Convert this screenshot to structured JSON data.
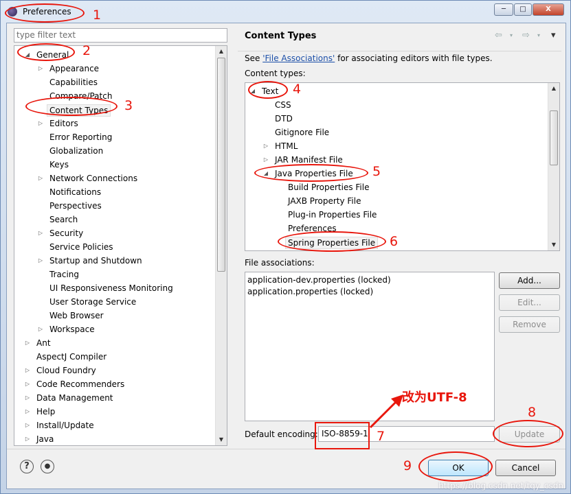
{
  "window": {
    "title": "Preferences",
    "minimize": "─",
    "maximize": "□",
    "close": "X"
  },
  "filter": {
    "placeholder": "type filter text"
  },
  "left_tree": [
    {
      "label": "General",
      "level": 0,
      "twisty": "expanded"
    },
    {
      "label": "Appearance",
      "level": 1,
      "twisty": "collapsed"
    },
    {
      "label": "Capabilities",
      "level": 1,
      "twisty": "none"
    },
    {
      "label": "Compare/Patch",
      "level": 1,
      "twisty": "none"
    },
    {
      "label": "Content Types",
      "level": 1,
      "twisty": "none",
      "selected": true
    },
    {
      "label": "Editors",
      "level": 1,
      "twisty": "collapsed"
    },
    {
      "label": "Error Reporting",
      "level": 1,
      "twisty": "none"
    },
    {
      "label": "Globalization",
      "level": 1,
      "twisty": "none"
    },
    {
      "label": "Keys",
      "level": 1,
      "twisty": "none"
    },
    {
      "label": "Network Connections",
      "level": 1,
      "twisty": "collapsed"
    },
    {
      "label": "Notifications",
      "level": 1,
      "twisty": "none"
    },
    {
      "label": "Perspectives",
      "level": 1,
      "twisty": "none"
    },
    {
      "label": "Search",
      "level": 1,
      "twisty": "none"
    },
    {
      "label": "Security",
      "level": 1,
      "twisty": "collapsed"
    },
    {
      "label": "Service Policies",
      "level": 1,
      "twisty": "none"
    },
    {
      "label": "Startup and Shutdown",
      "level": 1,
      "twisty": "collapsed"
    },
    {
      "label": "Tracing",
      "level": 1,
      "twisty": "none"
    },
    {
      "label": "UI Responsiveness Monitoring",
      "level": 1,
      "twisty": "none"
    },
    {
      "label": "User Storage Service",
      "level": 1,
      "twisty": "none"
    },
    {
      "label": "Web Browser",
      "level": 1,
      "twisty": "none"
    },
    {
      "label": "Workspace",
      "level": 1,
      "twisty": "collapsed"
    },
    {
      "label": "Ant",
      "level": 0,
      "twisty": "collapsed"
    },
    {
      "label": "AspectJ Compiler",
      "level": 0,
      "twisty": "none"
    },
    {
      "label": "Cloud Foundry",
      "level": 0,
      "twisty": "collapsed"
    },
    {
      "label": "Code Recommenders",
      "level": 0,
      "twisty": "collapsed"
    },
    {
      "label": "Data Management",
      "level": 0,
      "twisty": "collapsed"
    },
    {
      "label": "Help",
      "level": 0,
      "twisty": "collapsed"
    },
    {
      "label": "Install/Update",
      "level": 0,
      "twisty": "collapsed"
    },
    {
      "label": "Java",
      "level": 0,
      "twisty": "collapsed"
    }
  ],
  "page": {
    "title": "Content Types",
    "description_prefix": "See ",
    "description_link": "'File Associations'",
    "description_suffix": " for associating editors with file types.",
    "content_types_label": "Content types:",
    "file_assoc_label": "File associations:",
    "encoding_label": "Default encoding:",
    "encoding_value": "ISO-8859-1"
  },
  "content_tree": [
    {
      "label": "Text",
      "level": 0,
      "twisty": "expanded"
    },
    {
      "label": "CSS",
      "level": 1,
      "twisty": "none"
    },
    {
      "label": "DTD",
      "level": 1,
      "twisty": "none"
    },
    {
      "label": "Gitignore File",
      "level": 1,
      "twisty": "none"
    },
    {
      "label": "HTML",
      "level": 1,
      "twisty": "collapsed"
    },
    {
      "label": "JAR Manifest File",
      "level": 1,
      "twisty": "collapsed"
    },
    {
      "label": "Java Properties File",
      "level": 1,
      "twisty": "expanded"
    },
    {
      "label": "Build Properties File",
      "level": 2,
      "twisty": "none"
    },
    {
      "label": "JAXB Property File",
      "level": 2,
      "twisty": "none"
    },
    {
      "label": "Plug-in Properties File",
      "level": 2,
      "twisty": "none"
    },
    {
      "label": "Preferences",
      "level": 2,
      "twisty": "none"
    },
    {
      "label": "Spring Properties File",
      "level": 2,
      "twisty": "none",
      "selected": true
    }
  ],
  "file_associations": [
    "application-dev.properties (locked)",
    "application.properties (locked)"
  ],
  "buttons": {
    "add": "Add...",
    "edit": "Edit...",
    "remove": "Remove",
    "update": "Update",
    "ok": "OK",
    "cancel": "Cancel"
  },
  "icons": {
    "help": "?",
    "info": "●",
    "back": "⇦",
    "forward": "⇨",
    "menu": "▾"
  },
  "annotations": {
    "n1": "1",
    "n2": "2",
    "n3": "3",
    "n4": "4",
    "n5": "5",
    "n6": "6",
    "n7": "7",
    "n8": "8",
    "n9": "9",
    "note": "改为UTF-8",
    "color": "#e8160c"
  },
  "watermark": "https://blog.csdn.net/tqy_csdn"
}
